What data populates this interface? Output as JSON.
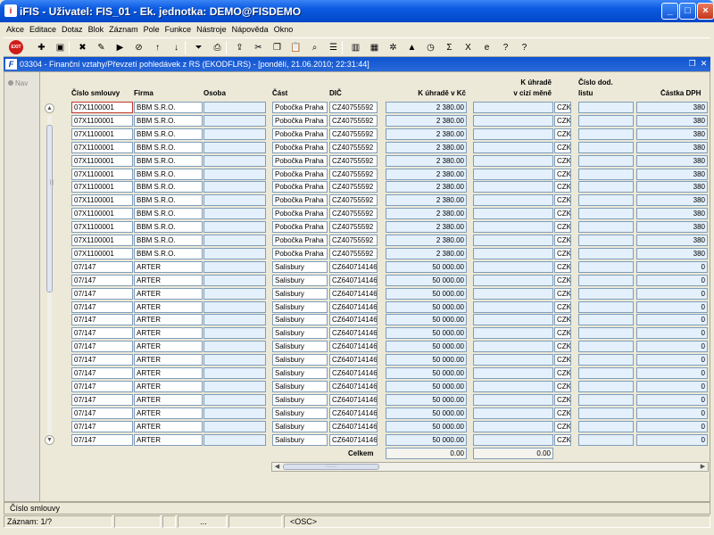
{
  "window": {
    "title": "iFIS - Uživatel: FIS_01 - Ek. jednotka: DEMO@FISDEMO",
    "icon_text": "i"
  },
  "menu": [
    "Akce",
    "Editace",
    "Dotaz",
    "Blok",
    "Záznam",
    "Pole",
    "Funkce",
    "Nástroje",
    "Nápověda",
    "Okno"
  ],
  "toolbar": {
    "exit_label": "EXIT",
    "icons": [
      "new-record-icon",
      "save-icon",
      "delete-record-icon",
      "enter-query-icon",
      "execute-query-icon",
      "cancel-query-icon",
      "sort-ascending-icon",
      "sort-descending-icon",
      "filter-icon",
      "print-icon",
      "export-icon",
      "cut-icon",
      "copy-icon",
      "paste-icon",
      "zoom-icon",
      "list-icon",
      "chart-icon",
      "calculator-icon",
      "settings-icon",
      "warning-icon",
      "clock-icon",
      "sum-icon",
      "excel-icon",
      "ie-icon",
      "help-pointer-icon",
      "question-icon"
    ]
  },
  "inner_window": {
    "title": "03304 - Finanční vztahy/Převzetí pohledávek z RS (EKODFLRS) - [pondělí, 21.06.2010; 22:31:44]",
    "icon_text": "F"
  },
  "nav": {
    "label": "Nav"
  },
  "columns": {
    "cislo_smlouvy": "Číslo smlouvy",
    "firma": "Firma",
    "osoba": "Osoba",
    "cast": "Část",
    "dic": "DIČ",
    "k_uhrade_kc": "K úhradě v Kč",
    "k_uhrade_cizi_1": "K úhradě",
    "k_uhrade_cizi_2": "v cizí měně",
    "cislo_dod_1": "Číslo dod.",
    "cislo_dod_2": "listu",
    "castka_dph": "Částka DPH"
  },
  "rows": [
    {
      "cislo": "07X1100001",
      "firma": "BBM S.R.O.",
      "osoba": "",
      "cast": "Pobočka Praha",
      "dic": "CZ40755592",
      "kc": "2 380.00",
      "cizi": "",
      "mena": "CZK",
      "dod": "",
      "dph": "380"
    },
    {
      "cislo": "07X1100001",
      "firma": "BBM S.R.O.",
      "osoba": "",
      "cast": "Pobočka Praha",
      "dic": "CZ40755592",
      "kc": "2 380.00",
      "cizi": "",
      "mena": "CZK",
      "dod": "",
      "dph": "380"
    },
    {
      "cislo": "07X1100001",
      "firma": "BBM S.R.O.",
      "osoba": "",
      "cast": "Pobočka Praha",
      "dic": "CZ40755592",
      "kc": "2 380.00",
      "cizi": "",
      "mena": "CZK",
      "dod": "",
      "dph": "380"
    },
    {
      "cislo": "07X1100001",
      "firma": "BBM S.R.O.",
      "osoba": "",
      "cast": "Pobočka Praha",
      "dic": "CZ40755592",
      "kc": "2 380.00",
      "cizi": "",
      "mena": "CZK",
      "dod": "",
      "dph": "380"
    },
    {
      "cislo": "07X1100001",
      "firma": "BBM S.R.O.",
      "osoba": "",
      "cast": "Pobočka Praha",
      "dic": "CZ40755592",
      "kc": "2 380.00",
      "cizi": "",
      "mena": "CZK",
      "dod": "",
      "dph": "380"
    },
    {
      "cislo": "07X1100001",
      "firma": "BBM S.R.O.",
      "osoba": "",
      "cast": "Pobočka Praha",
      "dic": "CZ40755592",
      "kc": "2 380.00",
      "cizi": "",
      "mena": "CZK",
      "dod": "",
      "dph": "380"
    },
    {
      "cislo": "07X1100001",
      "firma": "BBM S.R.O.",
      "osoba": "",
      "cast": "Pobočka Praha",
      "dic": "CZ40755592",
      "kc": "2 380.00",
      "cizi": "",
      "mena": "CZK",
      "dod": "",
      "dph": "380"
    },
    {
      "cislo": "07X1100001",
      "firma": "BBM S.R.O.",
      "osoba": "",
      "cast": "Pobočka Praha",
      "dic": "CZ40755592",
      "kc": "2 380.00",
      "cizi": "",
      "mena": "CZK",
      "dod": "",
      "dph": "380"
    },
    {
      "cislo": "07X1100001",
      "firma": "BBM S.R.O.",
      "osoba": "",
      "cast": "Pobočka Praha",
      "dic": "CZ40755592",
      "kc": "2 380.00",
      "cizi": "",
      "mena": "CZK",
      "dod": "",
      "dph": "380"
    },
    {
      "cislo": "07X1100001",
      "firma": "BBM S.R.O.",
      "osoba": "",
      "cast": "Pobočka Praha",
      "dic": "CZ40755592",
      "kc": "2 380.00",
      "cizi": "",
      "mena": "CZK",
      "dod": "",
      "dph": "380"
    },
    {
      "cislo": "07X1100001",
      "firma": "BBM S.R.O.",
      "osoba": "",
      "cast": "Pobočka Praha",
      "dic": "CZ40755592",
      "kc": "2 380.00",
      "cizi": "",
      "mena": "CZK",
      "dod": "",
      "dph": "380"
    },
    {
      "cislo": "07X1100001",
      "firma": "BBM S.R.O.",
      "osoba": "",
      "cast": "Pobočka Praha",
      "dic": "CZ40755592",
      "kc": "2 380.00",
      "cizi": "",
      "mena": "CZK",
      "dod": "",
      "dph": "380"
    },
    {
      "cislo": "07/147",
      "firma": "ARTER",
      "osoba": "",
      "cast": "Salisbury",
      "dic": "CZ640714146",
      "kc": "50 000.00",
      "cizi": "",
      "mena": "CZK",
      "dod": "",
      "dph": "0"
    },
    {
      "cislo": "07/147",
      "firma": "ARTER",
      "osoba": "",
      "cast": "Salisbury",
      "dic": "CZ640714146",
      "kc": "50 000.00",
      "cizi": "",
      "mena": "CZK",
      "dod": "",
      "dph": "0"
    },
    {
      "cislo": "07/147",
      "firma": "ARTER",
      "osoba": "",
      "cast": "Salisbury",
      "dic": "CZ640714146",
      "kc": "50 000.00",
      "cizi": "",
      "mena": "CZK",
      "dod": "",
      "dph": "0"
    },
    {
      "cislo": "07/147",
      "firma": "ARTER",
      "osoba": "",
      "cast": "Salisbury",
      "dic": "CZ640714146",
      "kc": "50 000.00",
      "cizi": "",
      "mena": "CZK",
      "dod": "",
      "dph": "0"
    },
    {
      "cislo": "07/147",
      "firma": "ARTER",
      "osoba": "",
      "cast": "Salisbury",
      "dic": "CZ640714146",
      "kc": "50 000.00",
      "cizi": "",
      "mena": "CZK",
      "dod": "",
      "dph": "0"
    },
    {
      "cislo": "07/147",
      "firma": "ARTER",
      "osoba": "",
      "cast": "Salisbury",
      "dic": "CZ640714146",
      "kc": "50 000.00",
      "cizi": "",
      "mena": "CZK",
      "dod": "",
      "dph": "0"
    },
    {
      "cislo": "07/147",
      "firma": "ARTER",
      "osoba": "",
      "cast": "Salisbury",
      "dic": "CZ640714146",
      "kc": "50 000.00",
      "cizi": "",
      "mena": "CZK",
      "dod": "",
      "dph": "0"
    },
    {
      "cislo": "07/147",
      "firma": "ARTER",
      "osoba": "",
      "cast": "Salisbury",
      "dic": "CZ640714146",
      "kc": "50 000.00",
      "cizi": "",
      "mena": "CZK",
      "dod": "",
      "dph": "0"
    },
    {
      "cislo": "07/147",
      "firma": "ARTER",
      "osoba": "",
      "cast": "Salisbury",
      "dic": "CZ640714146",
      "kc": "50 000.00",
      "cizi": "",
      "mena": "CZK",
      "dod": "",
      "dph": "0"
    },
    {
      "cislo": "07/147",
      "firma": "ARTER",
      "osoba": "",
      "cast": "Salisbury",
      "dic": "CZ640714146",
      "kc": "50 000.00",
      "cizi": "",
      "mena": "CZK",
      "dod": "",
      "dph": "0"
    },
    {
      "cislo": "07/147",
      "firma": "ARTER",
      "osoba": "",
      "cast": "Salisbury",
      "dic": "CZ640714146",
      "kc": "50 000.00",
      "cizi": "",
      "mena": "CZK",
      "dod": "",
      "dph": "0"
    },
    {
      "cislo": "07/147",
      "firma": "ARTER",
      "osoba": "",
      "cast": "Salisbury",
      "dic": "CZ640714146",
      "kc": "50 000.00",
      "cizi": "",
      "mena": "CZK",
      "dod": "",
      "dph": "0"
    },
    {
      "cislo": "07/147",
      "firma": "ARTER",
      "osoba": "",
      "cast": "Salisbury",
      "dic": "CZ640714146",
      "kc": "50 000.00",
      "cizi": "",
      "mena": "CZK",
      "dod": "",
      "dph": "0"
    },
    {
      "cislo": "07/147",
      "firma": "ARTER",
      "osoba": "",
      "cast": "Salisbury",
      "dic": "CZ640714146",
      "kc": "50 000.00",
      "cizi": "",
      "mena": "CZK",
      "dod": "",
      "dph": "0"
    }
  ],
  "totals": {
    "label": "Celkem",
    "kc": "0.00",
    "cizi": "0.00"
  },
  "status": {
    "message": "Číslo smlouvy",
    "record": "Záznam: 1/?",
    "sep": "...",
    "mode": "<OSC>"
  }
}
